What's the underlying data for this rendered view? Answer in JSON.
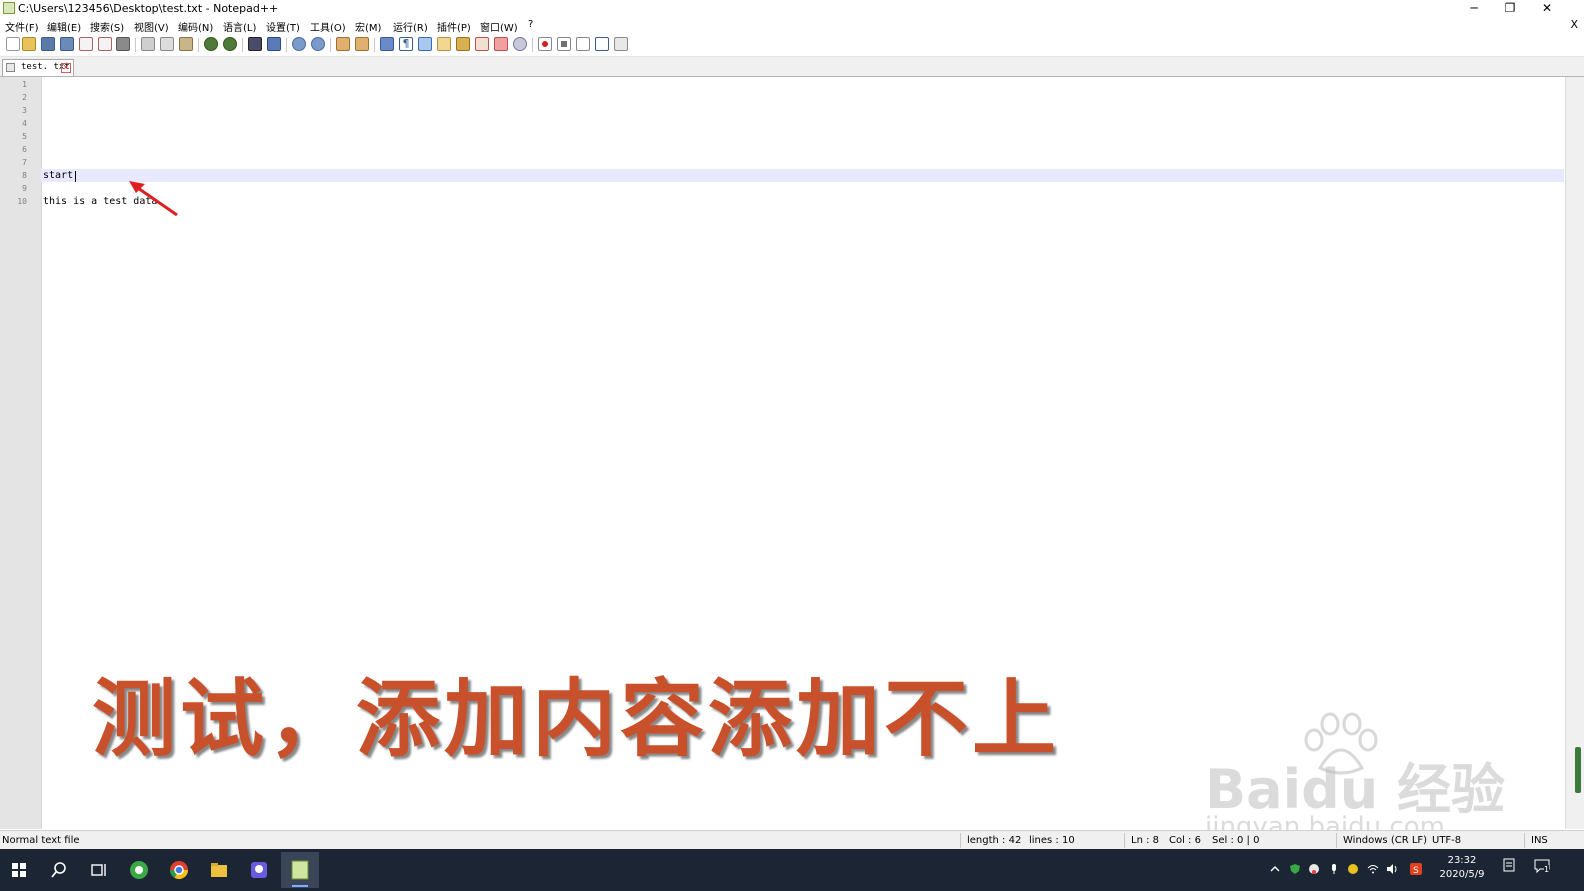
{
  "window": {
    "title": "C:\\Users\\123456\\Desktop\\test.txt - Notepad++",
    "minimize": "─",
    "restore": "❐",
    "close": "✕"
  },
  "menu": {
    "items": [
      "文件(F)",
      "编辑(E)",
      "搜索(S)",
      "视图(V)",
      "编码(N)",
      "语言(L)",
      "设置(T)",
      "工具(O)",
      "宏(M)",
      "运行(R)",
      "插件(P)",
      "窗口(W)",
      "?"
    ],
    "close_doc": "X"
  },
  "tab": {
    "label": "test. txt"
  },
  "editor": {
    "line_numbers": [
      "1",
      "2",
      "3",
      "4",
      "5",
      "6",
      "7",
      "8",
      "9",
      "10"
    ],
    "lines": [
      "",
      "",
      "",
      "",
      "",
      "",
      "",
      "start",
      "",
      "this is a test data"
    ],
    "current_line": 8
  },
  "overlay": {
    "caption": "测试，添加内容添加不上",
    "watermark": "Baidu 经验",
    "watermark_url": "jingyan.baidu.com",
    "caption_color": "#c8502a"
  },
  "status": {
    "file_type": "Normal text file",
    "length": "length : 42",
    "lines": "lines : 10",
    "ln": "Ln : 8",
    "col": "Col : 6",
    "sel": "Sel : 0 | 0",
    "eol": "Windows (CR LF)",
    "encoding": "UTF-8",
    "mode": "INS"
  },
  "taskbar": {
    "clock_time": "23:32",
    "clock_date": "2020/5/9",
    "notification_count": "1"
  }
}
